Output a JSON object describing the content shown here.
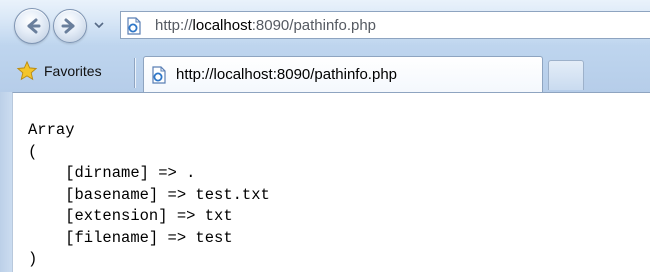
{
  "browser": {
    "address_prefix": "http://",
    "address_host": "localhost",
    "address_suffix": ":8090/pathinfo.php",
    "favorites_label": "Favorites",
    "tab_title": "http://localhost:8090/pathinfo.php",
    "icons": {
      "back": "back-arrow-icon",
      "forward": "forward-arrow-icon",
      "dropdown": "chevron-down-icon",
      "page": "page-icon",
      "favorites": "star-icon"
    }
  },
  "output": {
    "lines": [
      "Array",
      "(",
      "    [dirname] => .",
      "    [basename] => test.txt",
      "    [extension] => txt",
      "    [filename] => test",
      ")"
    ]
  }
}
